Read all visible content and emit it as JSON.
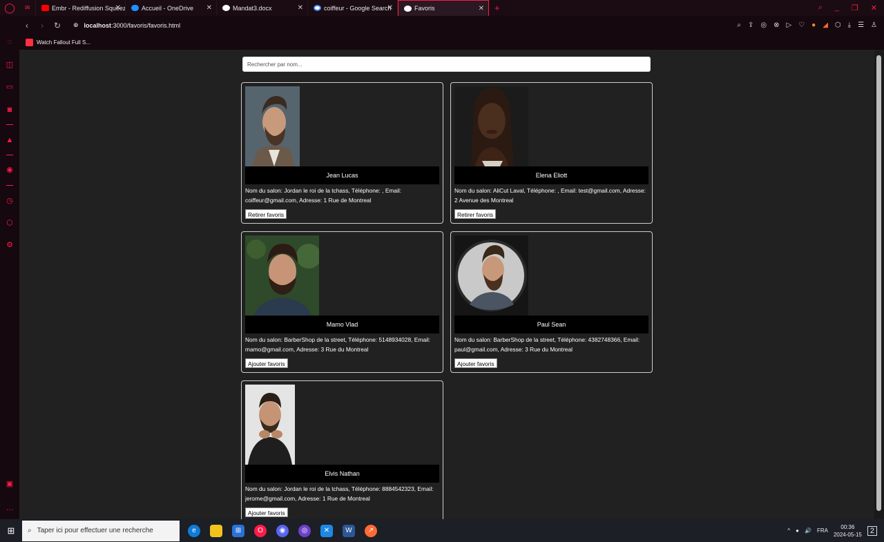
{
  "browser": {
    "tabs": [
      {
        "title": "Embr - Rediffusion Squeez",
        "color": "#ff0000"
      },
      {
        "title": "Accueil - OneDrive",
        "color": "#1e90ff"
      },
      {
        "title": "Mandat3.docx",
        "color": "#ffffff"
      },
      {
        "title": "coiffeur - Google Search",
        "color": "#ffffff"
      },
      {
        "title": "Favoris",
        "color": "#ffffff"
      }
    ],
    "url_host": "localhost",
    "url_path": ":3000/favoris/favoris.html",
    "bookmark": "Watch Fallout Full S..."
  },
  "search": {
    "placeholder": "Rechercher par nom..."
  },
  "cards": [
    {
      "name": "Jean Lucas",
      "info": "Nom du salon: Jordan le roi de la tchass, Téléphone: , Email: coiffeur@gmail.com, Adresse: 1 Rue de Montreal",
      "button": "Retirer favoris"
    },
    {
      "name": "Elena Eliott",
      "info": "Nom du salon: AliCut Laval, Téléphone: , Email: test@gmail.com, Adresse: 2 Avenue des Montreal",
      "button": "Retirer favoris"
    },
    {
      "name": "Mamo Vlad",
      "info": "Nom du salon: BarberShop de la street, Téléphone: 5148934028, Email: mamo@gmail.com, Adresse: 3 Rue du Montreal",
      "button": "Ajouter favoris"
    },
    {
      "name": "Paul Sean",
      "info": "Nom du salon: BarberShop de la street, Téléphone: 4382748366, Email: paul@gmail.com, Adresse: 3 Rue du Montreal",
      "button": "Ajouter favoris"
    },
    {
      "name": "Elvis Nathan",
      "info": "Nom du salon: Jordan le roi de la tchass, Téléphone: 8884542323, Email: jerome@gmail.com, Adresse: 1 Rue de Montreal",
      "button": "Ajouter favoris"
    }
  ],
  "taskbar": {
    "search_placeholder": "Taper ici pour effectuer une recherche",
    "language": "FRA",
    "time": "00:36",
    "date": "2024-05-15",
    "notifications": "2"
  },
  "colors": {
    "accent": "#ff1b4a",
    "background": "#212121"
  }
}
